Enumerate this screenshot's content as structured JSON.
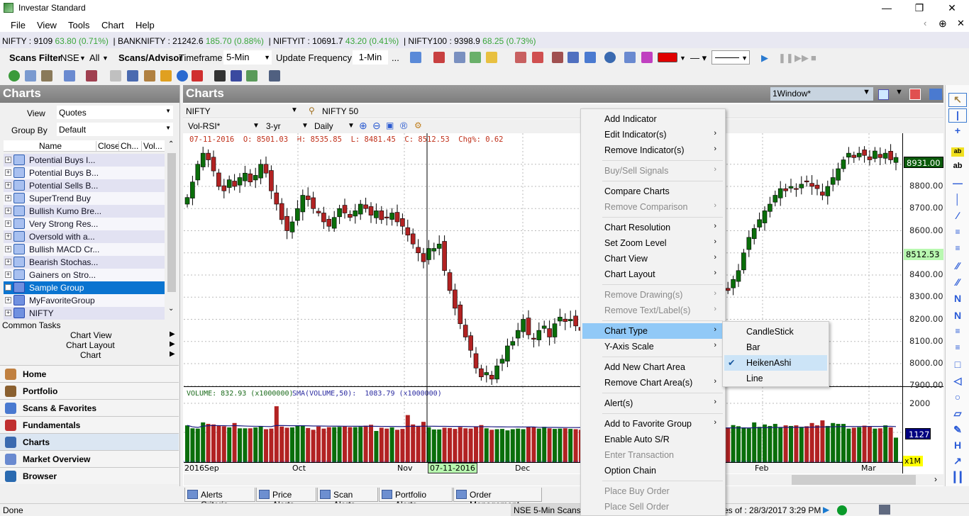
{
  "app": {
    "title": "Investar Standard"
  },
  "menubar": [
    "File",
    "View",
    "Tools",
    "Chart",
    "Help"
  ],
  "ticker": [
    {
      "name": "NIFTY : 9109",
      "chg": "63.80 (0.71%)"
    },
    {
      "name": "BANKNIFTY :  21242.6",
      "chg": "185.70 (0.88%)"
    },
    {
      "name": "NIFTYIT : 10691.7",
      "chg": "43.20 (0.41%)"
    },
    {
      "name": "NIFTY100 : 9398.9",
      "chg": "68.25 (0.73%)"
    }
  ],
  "toolbar": {
    "scans_filter": "Scans Filter",
    "exchange": "NSE",
    "all": "All",
    "scans_advisor": "Scans/Advisor",
    "timeframe_label": "Timeframe",
    "timeframe": "5-Min",
    "update_label": "Update Frequency",
    "update": "1-Min",
    "more": "..."
  },
  "left": {
    "title": "Charts",
    "view_label": "View",
    "view": "Quotes",
    "group_label": "Group By",
    "group": "Default",
    "columns": [
      "Name",
      "Close",
      "Ch...",
      "Vol..."
    ],
    "items": [
      "Potential Buys I...",
      "Potential Buys B...",
      "Potential Sells B...",
      "SuperTrend Buy",
      "Bullish Kumo Bre...",
      "Very Strong Res...",
      "Oversold with a...",
      "Bullish MACD Cr...",
      "Bearish Stochas...",
      "Gainers on Stro...",
      "Sample Group",
      "MyFavoriteGroup",
      "NIFTY"
    ],
    "selected": "Sample Group",
    "common_tasks": "Common Tasks",
    "tasks": [
      "Chart View",
      "Chart Layout",
      "Chart"
    ],
    "nav": [
      "Home",
      "Portfolio",
      "Scans & Favorites",
      "Fundamentals",
      "Charts",
      "Market Overview",
      "Browser"
    ],
    "nav_selected": "Charts"
  },
  "chart": {
    "title": "Charts",
    "window": "1Window*",
    "symbol": "NIFTY",
    "symbol_name": "NIFTY 50",
    "template": "Vol-RSI*",
    "period": "3-yr",
    "interval": "Daily",
    "ohlc_info": "07-11-2016  O: 8501.03  H: 8535.85  L: 8481.45  C: 8512.53  Chg%: 0.62",
    "volume_info": "VOLUME: 832.93 (x1000000)",
    "sma_info": "SMA(VOLUME,50):  1083.79 (x1000000)",
    "last_price": "8931.00",
    "cursor_price": "8512.53",
    "vol_label": "1127",
    "vol_scale": "x1M",
    "vol_tick": "2000",
    "cursor_date": "07-11-2016",
    "colors": {
      "up": "#0a6e0a",
      "down": "#b22222",
      "sma": "#1a1a80"
    }
  },
  "chart_data": {
    "type": "candlestick",
    "x_labels": [
      "2016Sep",
      "Oct",
      "Nov",
      "Dec",
      "Feb",
      "Mar"
    ],
    "y_ticks": [
      "8800.00",
      "8700.00",
      "8600.00",
      "8500.00",
      "8400.00",
      "8300.00",
      "8200.00",
      "8100.00",
      "8000.00",
      "7900.00"
    ],
    "closes": [
      8750,
      8820,
      8900,
      8950,
      8920,
      8870,
      8800,
      8780,
      8830,
      8800,
      8840,
      8860,
      8820,
      8850,
      8900,
      8860,
      8780,
      8720,
      8650,
      8600,
      8640,
      8700,
      8760,
      8740,
      8700,
      8680,
      8640,
      8620,
      8660,
      8700,
      8680,
      8660,
      8690,
      8720,
      8700,
      8670,
      8690,
      8650,
      8660,
      8680,
      8640,
      8620,
      8580,
      8540,
      8500,
      8460,
      8520,
      8520,
      8540,
      8420,
      8330,
      8250,
      8180,
      8120,
      8060,
      7980,
      7940,
      7960,
      7930,
      7990,
      8020,
      8080,
      8100,
      8150,
      8200,
      8130,
      8110,
      8150,
      8170,
      8120,
      8180,
      8210,
      8190,
      8200,
      8170,
      8150,
      8140,
      8120,
      8100,
      8080,
      8060,
      8030,
      8000,
      7990,
      8020,
      8060,
      8090,
      8130,
      8180,
      8200,
      8190,
      8230,
      8250,
      8240,
      8260,
      8280,
      8300,
      8290,
      8310,
      8330,
      8350,
      8360,
      8340,
      8330,
      8380,
      8420,
      8500,
      8570,
      8610,
      8650,
      8690,
      8720,
      8760,
      8790,
      8780,
      8800,
      8790,
      8810,
      8820,
      8800,
      8790,
      8760,
      8800,
      8840,
      8880,
      8920,
      8950,
      8930,
      8950,
      8940,
      8920,
      8960,
      8930,
      8950,
      8920,
      8931
    ],
    "volumes": [
      1250,
      1150,
      1140,
      1350,
      1300,
      1280,
      1230,
      1220,
      1180,
      1330,
      1150,
      1150,
      1150,
      1180,
      1220,
      1120,
      1140,
      1900,
      1210,
      1170,
      1180,
      1230,
      1250,
      1160,
      1100,
      1210,
      1140,
      1190,
      1190,
      1200,
      1210,
      1190,
      1190,
      1200,
      1240,
      1270,
      1060,
      1170,
      1140,
      1180,
      1100,
      1130,
      1600,
      1280,
      1230,
      1370,
      1190,
      1110,
      1110,
      1170,
      1160,
      1130,
      1190,
      1150,
      1140,
      1200,
      1260,
      1150,
      1100,
      1120,
      1130,
      1080,
      1120,
      1140,
      1120,
      1200,
      1190,
      1140,
      1200,
      1150,
      1130,
      1140,
      1150,
      1130,
      1120,
      1100,
      1150,
      1120,
      1180,
      1200,
      1170,
      1130,
      1110,
      1150,
      1180,
      1200,
      1220,
      1160,
      1140,
      1170,
      1190,
      1200,
      1150,
      1180,
      1220,
      1130,
      1160,
      1200,
      1240,
      1180,
      1150,
      1130,
      1300,
      1170,
      1260,
      1220,
      1180,
      1150,
      1350,
      1200,
      1280,
      1230,
      1300,
      1180,
      1250,
      1230,
      1250,
      1200,
      1220,
      1330,
      1250,
      1420,
      1230,
      1330,
      1300,
      1300,
      1140,
      1170,
      1190,
      1240,
      1200,
      1140,
      1150,
      1250,
      1180,
      833
    ]
  },
  "context_menu": [
    {
      "label": "Add Indicator"
    },
    {
      "label": "Edit Indicator(s)",
      "sub": true
    },
    {
      "label": "Remove Indicator(s)",
      "sub": true
    },
    {
      "sep": true
    },
    {
      "label": "Buy/Sell Signals",
      "sub": true,
      "disabled": true
    },
    {
      "sep": true
    },
    {
      "label": "Compare Charts"
    },
    {
      "label": "Remove Comparison",
      "sub": true,
      "disabled": true
    },
    {
      "sep": true
    },
    {
      "label": "Chart Resolution",
      "sub": true
    },
    {
      "label": "Set Zoom Level",
      "sub": true
    },
    {
      "label": "Chart View",
      "sub": true
    },
    {
      "label": "Chart Layout",
      "sub": true
    },
    {
      "sep": true
    },
    {
      "label": "Remove Drawing(s)",
      "sub": true,
      "disabled": true
    },
    {
      "label": "Remove Text/Label(s)",
      "sub": true,
      "disabled": true
    },
    {
      "sep": true
    },
    {
      "label": "Chart Type",
      "sub": true,
      "highlighted": true
    },
    {
      "label": "Y-Axis Scale",
      "sub": true
    },
    {
      "sep": true
    },
    {
      "label": "Add New Chart Area"
    },
    {
      "label": "Remove Chart Area(s)",
      "sub": true
    },
    {
      "sep": true
    },
    {
      "label": "Alert(s)",
      "sub": true
    },
    {
      "sep": true
    },
    {
      "label": "Add to Favorite Group",
      "sub": true
    },
    {
      "label": "Enable Auto S/R"
    },
    {
      "label": "Enter Transaction",
      "disabled": true
    },
    {
      "label": "Option Chain"
    },
    {
      "sep": true
    },
    {
      "label": "Place Buy Order",
      "disabled": true
    },
    {
      "label": "Place Sell Order",
      "disabled": true
    }
  ],
  "submenu": {
    "items": [
      "CandleStick",
      "Bar",
      "HeikenAshi",
      "Line"
    ],
    "checked": "HeikenAshi"
  },
  "tabs": [
    "Alerts Criteria",
    "Price Alerts",
    "Scan Alerts",
    "Portfolio Alerts",
    "Order Management"
  ],
  "status": {
    "left": "Done",
    "scans": "NSE 5-Min Scans",
    "asof": "es of : 28/3/2017 3:29 PM"
  }
}
